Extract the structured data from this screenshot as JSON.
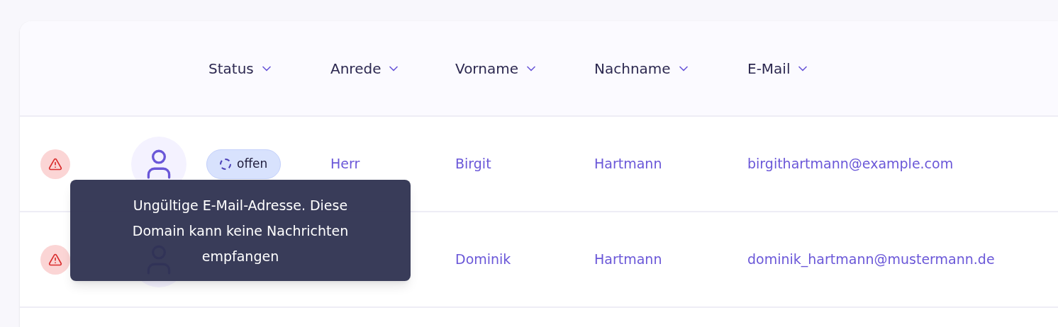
{
  "table": {
    "columns": [
      {
        "label": "Status"
      },
      {
        "label": "Anrede"
      },
      {
        "label": "Vorname"
      },
      {
        "label": "Nachname"
      },
      {
        "label": "E-Mail"
      }
    ],
    "rows": [
      {
        "warning": true,
        "status": "offen",
        "anrede": "Herr",
        "vorname": "Birgit",
        "nachname": "Hartmann",
        "email": "birgithartmann@example.com"
      },
      {
        "warning": true,
        "vorname": "Dominik",
        "nachname": "Hartmann",
        "email": "dominik_hartmann@mustermann.de"
      }
    ]
  },
  "tooltip": {
    "text": "Ungültige E-Mail-Adresse. Diese Domain kann keine Nachrichten empfangen"
  }
}
